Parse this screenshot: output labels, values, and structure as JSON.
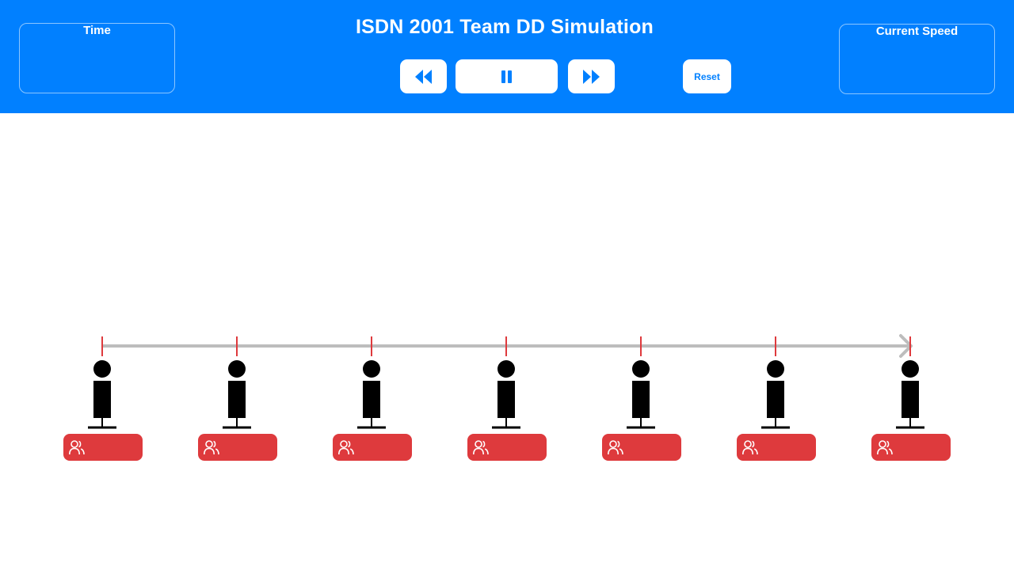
{
  "header": {
    "title": "ISDN 2001 Team DD Simulation",
    "time_label": "Time",
    "time_value": "",
    "speed_label": "Current Speed",
    "speed_value": "",
    "reset_label": "Reset",
    "background_color": "#0180ff"
  },
  "controls": [
    {
      "name": "rewind-button",
      "icon": "rewind-icon"
    },
    {
      "name": "pause-button",
      "icon": "pause-icon"
    },
    {
      "name": "fast-forward-button",
      "icon": "fast-forward-icon"
    }
  ],
  "track": {
    "line_color": "#bdbdbd",
    "tick_color": "#de3a3d",
    "arrow_icon": "chevron-right-icon"
  },
  "stations": [
    {
      "icon": "person-figure-icon",
      "badge_icon": "users-icon",
      "passenger_count": ""
    },
    {
      "icon": "person-figure-icon",
      "badge_icon": "users-icon",
      "passenger_count": ""
    },
    {
      "icon": "person-figure-icon",
      "badge_icon": "users-icon",
      "passenger_count": ""
    },
    {
      "icon": "person-figure-icon",
      "badge_icon": "users-icon",
      "passenger_count": ""
    },
    {
      "icon": "person-figure-icon",
      "badge_icon": "users-icon",
      "passenger_count": ""
    },
    {
      "icon": "person-figure-icon",
      "badge_icon": "users-icon",
      "passenger_count": ""
    },
    {
      "icon": "person-figure-icon",
      "badge_icon": "users-icon",
      "passenger_count": ""
    }
  ],
  "badge_color": "#de3a3d"
}
